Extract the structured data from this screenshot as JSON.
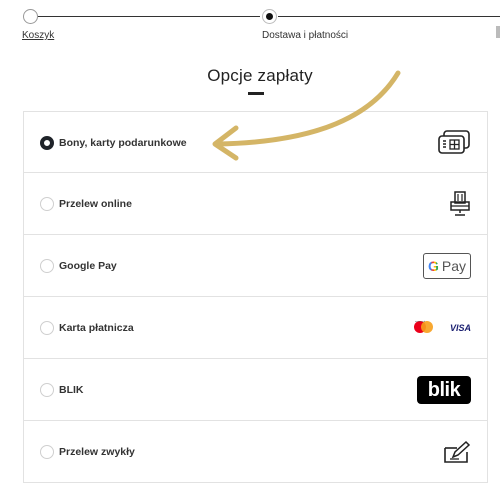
{
  "stepper": {
    "steps": [
      {
        "label": "Koszyk",
        "state": "done"
      },
      {
        "label": "Dostawa i płatności",
        "state": "current"
      }
    ]
  },
  "heading": {
    "title": "Opcje zapłaty"
  },
  "payment_options": [
    {
      "label": "Bony, karty podarunkowe",
      "selected": true,
      "icon": "gift-card-icon"
    },
    {
      "label": "Przelew online",
      "selected": false,
      "icon": "online-transfer-icon"
    },
    {
      "label": "Google Pay",
      "selected": false,
      "icon": "google-pay-icon"
    },
    {
      "label": "Karta płatnicza",
      "selected": false,
      "icon": "mastercard-visa-icon"
    },
    {
      "label": "BLIK",
      "selected": false,
      "icon": "blik-icon"
    },
    {
      "label": "Przelew zwykły",
      "selected": false,
      "icon": "bank-transfer-icon"
    }
  ],
  "logos": {
    "google_pay_g": "G",
    "google_pay_text": "Pay",
    "visa": "VISA",
    "mastercard_text": "mastercard",
    "blik": "blik"
  },
  "colors": {
    "annotation_arrow": "#d4b566",
    "selected_radio": "#1f2329"
  }
}
